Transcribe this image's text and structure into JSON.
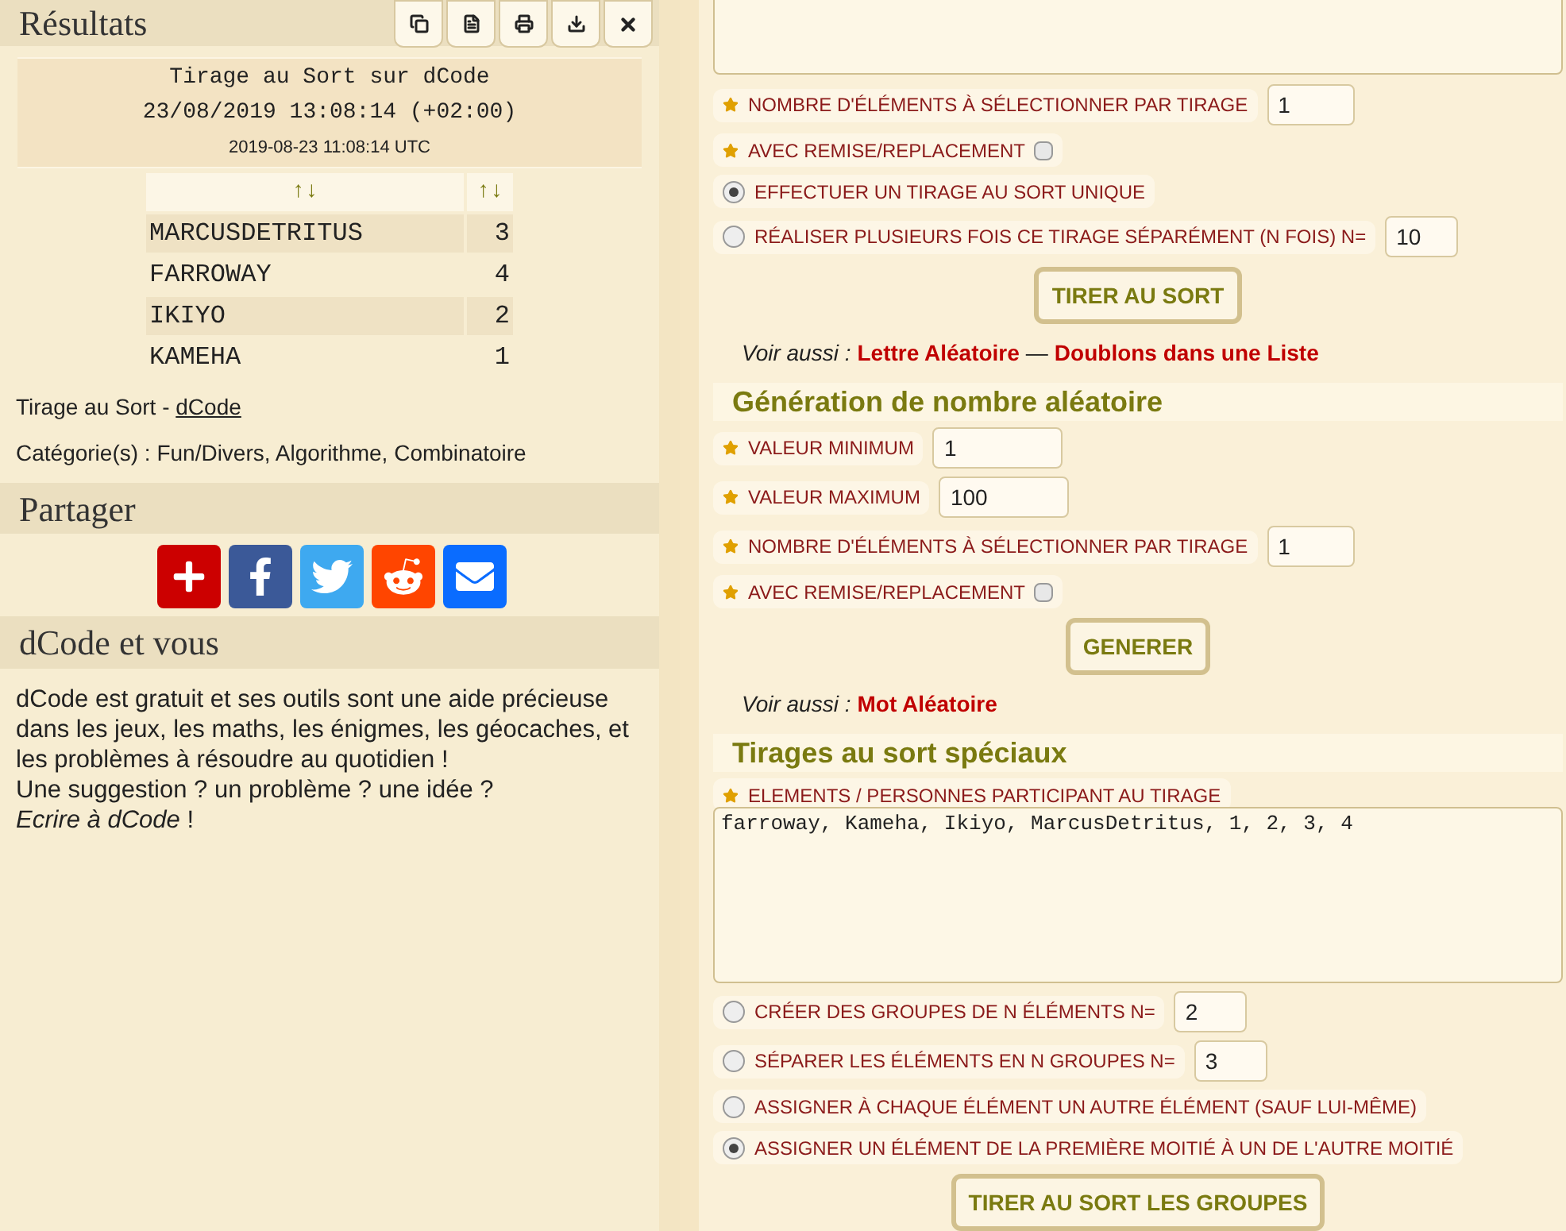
{
  "results": {
    "title": "Résultats",
    "summary": {
      "lines": [
        "Tirage au Sort sur dCode",
        "23/08/2019 13:08:14 (+02:00)"
      ],
      "utc": "2019-08-23 11:08:14 UTC"
    },
    "table": {
      "headers": [
        "↑↓",
        "↑↓"
      ],
      "rows": [
        {
          "name": "MARCUSDETRITUS",
          "count": "3"
        },
        {
          "name": "FARROWAY",
          "count": "4"
        },
        {
          "name": "IKIYO",
          "count": "2"
        },
        {
          "name": "KAMEHA",
          "count": "1"
        }
      ]
    },
    "credit": {
      "text": "Tirage au Sort - ",
      "link": "dCode"
    },
    "categories": "Catégorie(s) : Fun/Divers, Algorithme, Combinatoire"
  },
  "share": {
    "title": "Partager"
  },
  "about": {
    "title": "dCode et vous",
    "text": "dCode est gratuit et ses outils sont une aide précieuse dans les jeux, les maths, les énigmes, les géocaches, et les problèmes à résoudre au quotidien !",
    "question": "Une suggestion ? un problème ? une idée ? ",
    "link": "Ecrire à dCode",
    "end": " !"
  },
  "sections": [
    {
      "rows": [
        {
          "kind": "number",
          "label": "NOMBRE D'ÉLÉMENTS À SÉLECTIONNER PAR TIRAGE",
          "value": "1"
        },
        {
          "kind": "checkbox",
          "label": "AVEC REMISE/REPLACEMENT",
          "checked": false
        },
        {
          "kind": "radio",
          "label": "EFFECTUER UN TIRAGE AU SORT UNIQUE",
          "selected": true
        },
        {
          "kind": "radio",
          "label": "RÉALISER PLUSIEURS FOIS CE TIRAGE SÉPARÉMENT (N FOIS) N=",
          "selected": false,
          "value": "10"
        }
      ],
      "button": "TIRER AU SORT",
      "see_also": {
        "label": "Voir aussi :",
        "links": [
          "Lettre Aléatoire",
          "Doublons dans une Liste"
        ],
        "separator": "—"
      }
    },
    {
      "heading": "Génération de nombre aléatoire",
      "rows": [
        {
          "kind": "number",
          "label": "VALEUR MINIMUM",
          "value": "1"
        },
        {
          "kind": "number",
          "label": "VALEUR MAXIMUM",
          "value": "100"
        },
        {
          "kind": "number",
          "label": "NOMBRE D'ÉLÉMENTS À SÉLECTIONNER PAR TIRAGE",
          "value": "1"
        },
        {
          "kind": "checkbox",
          "label": "AVEC REMISE/REPLACEMENT",
          "checked": false
        }
      ],
      "button": "GENERER",
      "see_also": {
        "label": "Voir aussi :",
        "links": [
          "Mot Aléatoire"
        ]
      }
    },
    {
      "heading": "Tirages au sort spéciaux",
      "rows": [
        {
          "kind": "textarea",
          "label": "ELEMENTS / PERSONNES PARTICIPANT AU TIRAGE",
          "value": "farroway, Kameha, Ikiyo, MarcusDetritus, 1, 2, 3, 4"
        },
        {
          "kind": "radio",
          "label": "CRÉER DES GROUPES DE N ÉLÉMENTS N=",
          "selected": false,
          "value": "2"
        },
        {
          "kind": "radio",
          "label": "SÉPARER LES ÉLÉMENTS EN N GROUPES N=",
          "selected": false,
          "value": "3"
        },
        {
          "kind": "radio",
          "label": "ASSIGNER À CHAQUE ÉLÉMENT UN AUTRE ÉLÉMENT (SAUF LUI-MÊME)",
          "selected": false
        },
        {
          "kind": "radio",
          "label": "ASSIGNER UN ÉLÉMENT DE LA PREMIÈRE MOITIÉ À UN DE L'AUTRE MOITIÉ",
          "selected": true
        }
      ],
      "button": "TIRER AU SORT LES GROUPES"
    }
  ]
}
